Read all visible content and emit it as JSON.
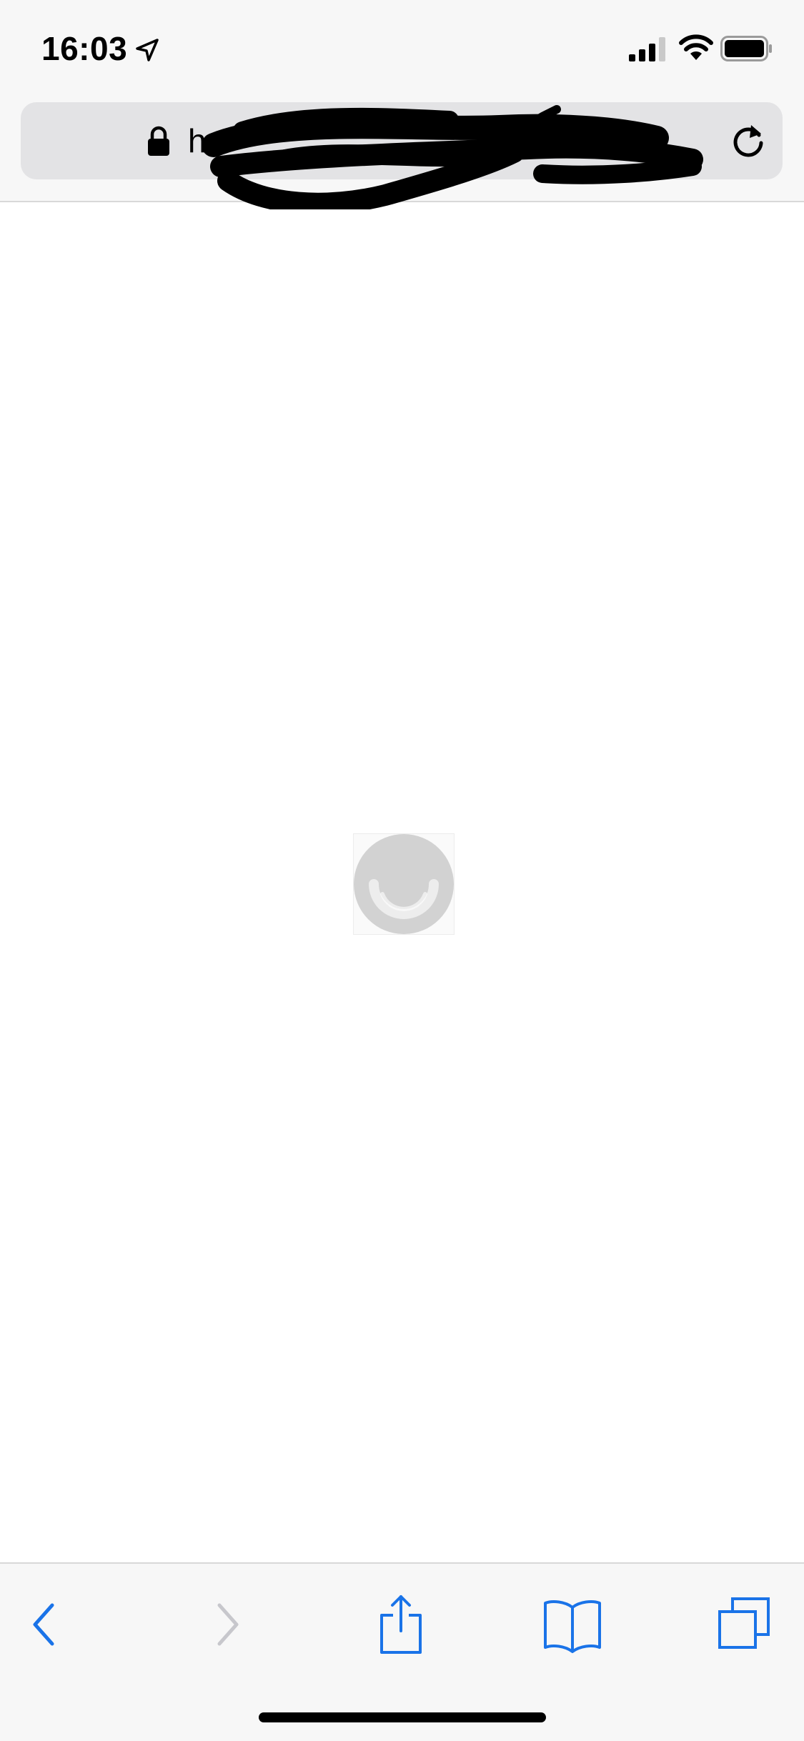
{
  "status_bar": {
    "time": "16:03",
    "icons": [
      "location-arrow-icon",
      "cellular-signal-icon",
      "wifi-icon",
      "battery-icon"
    ]
  },
  "address_bar": {
    "url_visible_prefix": "h",
    "url_redacted": true,
    "icons": [
      "lock-icon",
      "reload-icon"
    ]
  },
  "content": {
    "state": "loading",
    "indicator": "loading-spinner-icon"
  },
  "toolbar": {
    "buttons": [
      {
        "name": "back",
        "icon": "chevron-left-icon",
        "enabled": true
      },
      {
        "name": "forward",
        "icon": "chevron-right-icon",
        "enabled": false
      },
      {
        "name": "share",
        "icon": "share-icon",
        "enabled": true
      },
      {
        "name": "bookmarks",
        "icon": "book-icon",
        "enabled": true
      },
      {
        "name": "tabs",
        "icon": "tabs-icon",
        "enabled": true
      }
    ]
  },
  "colors": {
    "accent": "#1a73e8",
    "disabled": "#c7c7cc",
    "chrome_bg": "#f7f7f7",
    "address_bg": "#e3e3e5"
  }
}
